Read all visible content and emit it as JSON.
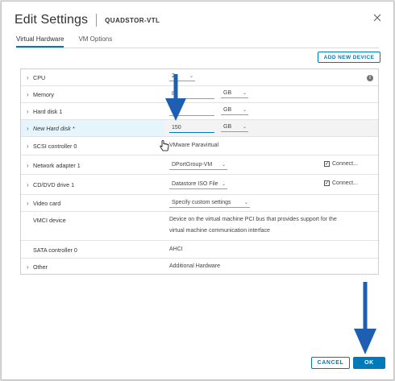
{
  "dialog": {
    "title": "Edit Settings",
    "vm_name": "QUADSTOR-VTL"
  },
  "tabs": [
    {
      "label": "Virtual Hardware",
      "active": true
    },
    {
      "label": "VM Options",
      "active": false
    }
  ],
  "add_device_label": "ADD NEW DEVICE",
  "rows": {
    "cpu": {
      "label": "CPU",
      "value": "2"
    },
    "memory": {
      "label": "Memory",
      "value": "8",
      "unit": "GB"
    },
    "hard_disk_1": {
      "label": "Hard disk 1",
      "unit": "GB"
    },
    "new_hard_disk": {
      "label": "New Hard disk *",
      "value": "150",
      "unit": "GB"
    },
    "scsi": {
      "label": "SCSI controller 0",
      "value": "VMware Paravirtual"
    },
    "network": {
      "label": "Network adapter 1",
      "value": "DPortGroup-VM",
      "connect_label": "Connect...",
      "connected": true
    },
    "cddvd": {
      "label": "CD/DVD drive 1",
      "value": "Datastore ISO File",
      "connect_label": "Connect...",
      "connected": true
    },
    "video": {
      "label": "Video card",
      "value": "Specify custom settings"
    },
    "vmci": {
      "label": "VMCI device",
      "line1": "Device on the virtual machine PCI bus that provides support for the",
      "line2": "virtual machine communication interface"
    },
    "sata": {
      "label": "SATA controller 0",
      "value": "AHCI"
    },
    "other": {
      "label": "Other",
      "value": "Additional Hardware"
    }
  },
  "footer": {
    "cancel_label": "CANCEL",
    "ok_label": "OK"
  },
  "colors": {
    "accent": "#0079b8",
    "annotation_arrow": "#1f5fb3"
  },
  "icons": {
    "close": "close-icon",
    "info": "info-icon",
    "expand": "chevron-right-icon",
    "dropdown": "chevron-down-icon"
  }
}
